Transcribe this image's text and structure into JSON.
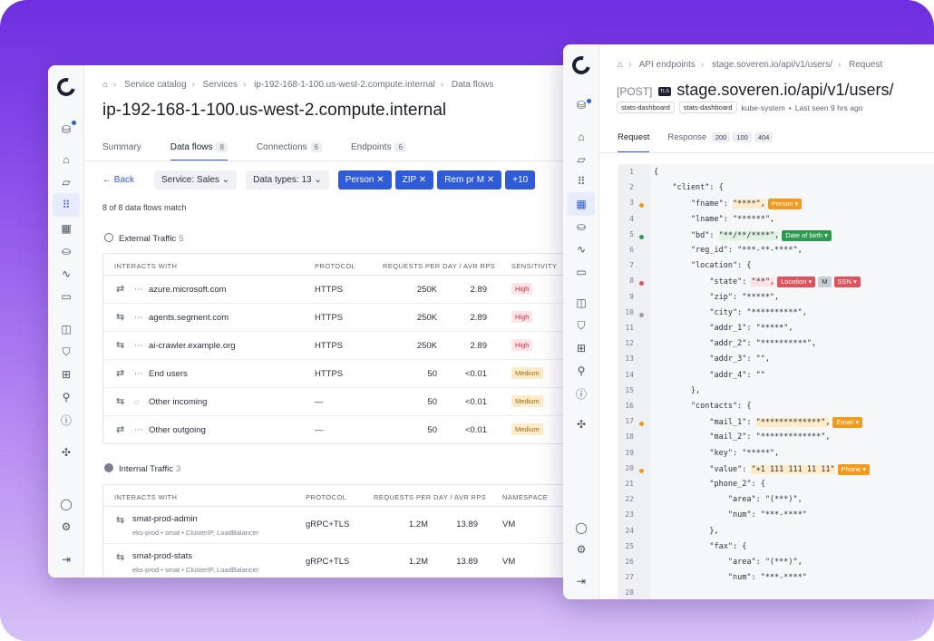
{
  "left": {
    "breadcrumb": [
      "Service catalog",
      "Services",
      "ip-192-168-1-100.us-west-2.compute.internal",
      "Data flows"
    ],
    "title": "ip-192-168-1-100.us-west-2.compute.internal",
    "tabs": [
      {
        "label": "Summary",
        "count": ""
      },
      {
        "label": "Data flows",
        "count": "8"
      },
      {
        "label": "Connections",
        "count": "6"
      },
      {
        "label": "Endpoints",
        "count": "6"
      }
    ],
    "back_label": "Back",
    "service_select": "Service: Sales",
    "datatypes_select": "Data types: 13",
    "chips": [
      "Person",
      "ZIP",
      "Rem pr M"
    ],
    "more_chip": "+10",
    "match_text": "8 of 8 data flows match",
    "external": {
      "title": "External Traffic",
      "count": "5",
      "headers": [
        "INTERACTS WITH",
        "PROTOCOL",
        "REQUESTS PER DAY / AVR RPS",
        "SENSITIVITY"
      ],
      "rows": [
        {
          "name": "azure.microsoft.com",
          "protocol": "HTTPS",
          "requests": "250K",
          "rps": "2.89",
          "sensitivity": "High"
        },
        {
          "name": "agents.segment.com",
          "protocol": "HTTPS",
          "requests": "250K",
          "rps": "2.89",
          "sensitivity": "High"
        },
        {
          "name": "ai-crawler.example.org",
          "protocol": "HTTPS",
          "requests": "250K",
          "rps": "2.89",
          "sensitivity": "High"
        },
        {
          "name": "End users",
          "protocol": "HTTPS",
          "requests": "50",
          "rps": "<0.01",
          "sensitivity": "Medium"
        },
        {
          "name": "Other incoming",
          "protocol": "—",
          "requests": "50",
          "rps": "<0.01",
          "sensitivity": "Medium"
        },
        {
          "name": "Other outgoing",
          "protocol": "—",
          "requests": "50",
          "rps": "<0.01",
          "sensitivity": "Medium"
        }
      ]
    },
    "internal": {
      "title": "Internal Traffic",
      "count": "3",
      "headers": [
        "INTERACTS WITH",
        "PROTOCOL",
        "REQUESTS PER DAY / AVR RPS",
        "NAMESPACE"
      ],
      "rows": [
        {
          "name": "smat-prod-admin",
          "sub": "eks-prod • smat • ClusterIP, LoadBalancer",
          "protocol": "gRPC+TLS",
          "requests": "1.2M",
          "rps": "13.89",
          "namespace": "VM"
        },
        {
          "name": "smat-prod-stats",
          "sub": "eks-prod • smat • ClusterIP, LoadBalancer",
          "protocol": "gRPC+TLS",
          "requests": "1.2M",
          "rps": "13.89",
          "namespace": "VM"
        }
      ]
    }
  },
  "right": {
    "breadcrumb": [
      "API endpoints",
      "stage.soveren.io/api/v1/users/",
      "Request"
    ],
    "method": "[POST]",
    "tls": "TLS",
    "endpoint": "stage.soveren.io/api/v1/users/",
    "tag1": "stats-dashboard",
    "tag2": "stats-dashboard",
    "cluster": "kube-system",
    "last_seen": "Last seen 9 hrs ago",
    "tab_request": "Request",
    "tab_response": "Response",
    "response_codes": [
      "200",
      "100",
      "404"
    ],
    "code": [
      {
        "n": "1",
        "t": "{"
      },
      {
        "n": "2",
        "t": "    \"client\": {"
      },
      {
        "n": "3",
        "t": "        \"fname\": ",
        "hl": "\"****\",",
        "lbl": "Person",
        "lc": "or",
        "dot": "#f39a1c"
      },
      {
        "n": "4",
        "t": "        \"lname\": \"******\","
      },
      {
        "n": "5",
        "t": "        \"bd\": ",
        "hl": "\"**/**/****\",",
        "lbl": "Date of birth",
        "lc": "gr",
        "hc": "g",
        "dot": "#2c9b4f"
      },
      {
        "n": "6",
        "t": "        \"reg_id\": \"***-**-****\","
      },
      {
        "n": "7",
        "t": "        \"location\": {"
      },
      {
        "n": "8",
        "t": "            \"state\": ",
        "hl": "\"**\",",
        "lbl": "Location",
        "lc": "rd",
        "hc": "r",
        "lbl2": "M",
        "lbl3": "SSN",
        "dot": "#e0535d"
      },
      {
        "n": "9",
        "t": "            \"zip\": \"*****\","
      },
      {
        "n": "10",
        "t": "            \"city\": \"**********\",",
        "dot": "#9aa0ab"
      },
      {
        "n": "11",
        "t": "            \"addr_1\": \"*****\","
      },
      {
        "n": "12",
        "t": "            \"addr_2\": \"**********\","
      },
      {
        "n": "13",
        "t": "            \"addr_3\": \"\","
      },
      {
        "n": "14",
        "t": "            \"addr_4\": \"\""
      },
      {
        "n": "15",
        "t": "        },"
      },
      {
        "n": "16",
        "t": "        \"contacts\": {"
      },
      {
        "n": "17",
        "t": "            \"mail_1\": ",
        "hl": "\"*************\",",
        "lbl": "Email",
        "lc": "or",
        "dot": "#f39a1c"
      },
      {
        "n": "18",
        "t": "            \"mail_2\": \"*************\","
      },
      {
        "n": "19",
        "t": "            \"key\": \"*****\","
      },
      {
        "n": "20",
        "t": "            \"value\": ",
        "hl": "\"+1 111 111 11 11\"",
        "lbl": "Phone",
        "lc": "or",
        "dot": "#f39a1c"
      },
      {
        "n": "21",
        "t": "            \"phone_2\": {"
      },
      {
        "n": "22",
        "t": "                \"area\": \"(***)\","
      },
      {
        "n": "23",
        "t": "                \"num\": \"***-****\""
      },
      {
        "n": "24",
        "t": "            },"
      },
      {
        "n": "25",
        "t": "            \"fax\": {"
      },
      {
        "n": "26",
        "t": "                \"area\": \"(***)\","
      },
      {
        "n": "27",
        "t": "                \"num\": \"***-****\""
      },
      {
        "n": "28",
        "t": ""
      }
    ]
  }
}
